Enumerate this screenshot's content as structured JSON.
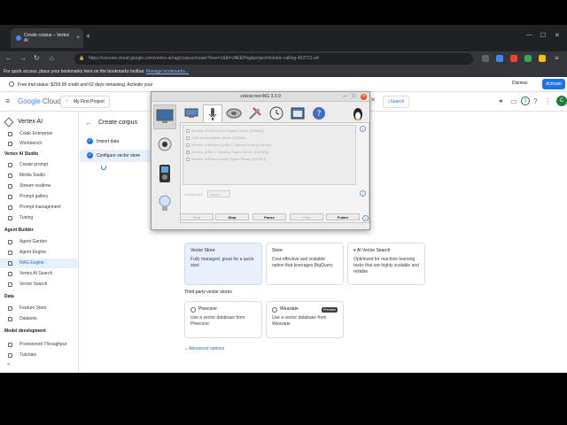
{
  "browser": {
    "tab_title": "Create corpus – Vertex AI",
    "tab_close": "×",
    "new_tab": "+",
    "url": "https://console.cloud.google.com/vertex-ai/rag/corpus/create?mvs=1&hl=cAEEPhg&project=kinetic-calling-463721-a4",
    "bookmarks_prefix": "For quick access, place your bookmarks here on the bookmarks toolbar.",
    "bookmarks_link": "Manage bookmarks..."
  },
  "trial_bar": {
    "text": "Free trial status: $299.99 credit and 62 days remaining. Activate your",
    "dismiss": "Dismiss",
    "activate": "Activate"
  },
  "header": {
    "logo_google": "Google",
    "logo_cloud": "Cloud",
    "project": "My First Project",
    "search_label": "Search",
    "notification_count": "1",
    "avatar_letter": "C"
  },
  "sidebar": {
    "title": "Vertex AI",
    "items_top": [
      "Colab Enterprise",
      "Workbench"
    ],
    "section_studio": "Vertex AI Studio",
    "items_studio": [
      "Create prompt",
      "Media Studio",
      "Stream realtime",
      "Prompt gallery",
      "Prompt management",
      "Tuning"
    ],
    "section_agent": "Agent Builder",
    "items_agent": [
      "Agent Garden",
      "Agent Engine",
      "RAG Engine",
      "Vertex AI Search",
      "Vector Search"
    ],
    "section_data": "Data",
    "items_data": [
      "Feature Store",
      "Datasets"
    ],
    "section_model": "Model development",
    "items_model": [
      "Provisioned Throughput",
      "Tutorials"
    ],
    "collapse": "«"
  },
  "main": {
    "page_title": "Create corpus",
    "steps": [
      {
        "num": "✓",
        "label": "Import data"
      },
      {
        "num": "✓",
        "label": "Configure vector store"
      }
    ],
    "cards": [
      {
        "title": "Vector Store",
        "desc": "Fully managed, great for a quick start"
      },
      {
        "title": "Store",
        "desc": "Cost-effective and scalable option that leverages BigQuery"
      },
      {
        "title": "e AI Vector Search",
        "desc": "Optimized for machine learning tasks that are highly scalable and reliable"
      }
    ],
    "third_party_title": "Third party vector stores",
    "third_party": [
      {
        "title": "Pinecone",
        "desc": "Use a vector database from Pinecone",
        "badge": ""
      },
      {
        "title": "Weaviate",
        "desc": "Use a vector database from Weaviate",
        "badge": "Preview"
      }
    ],
    "advanced": "Advanced options"
  },
  "vokoscreen": {
    "title": "vokoscreenNG 3.0.9",
    "devices": [
      "Monitor of USB-Audio-Digital Device (SIGMA)",
      "USB-Audio-Digital Stereo (SIGMA)",
      "Monitor of Modem (USB-C Speaker Analog Stereo)",
      "Modem (USB-C Speaker Digital Stereo (SIGMA))",
      "Monitor of Built-in Audio Digital Stereo (HDMI 4)"
    ],
    "device_checked": [
      false,
      false,
      false,
      true,
      false
    ],
    "codec_label": "Audiocodec",
    "codec_value": "audio/…",
    "info": "i",
    "buttons": {
      "start": "Start",
      "stop": "Stop",
      "pause": "Pause",
      "play": "Play",
      "folder": "Folder"
    }
  },
  "colors": {
    "accent": "#1a73e8",
    "active_bg": "#e8f0fe",
    "close_orange": "#e95420"
  }
}
